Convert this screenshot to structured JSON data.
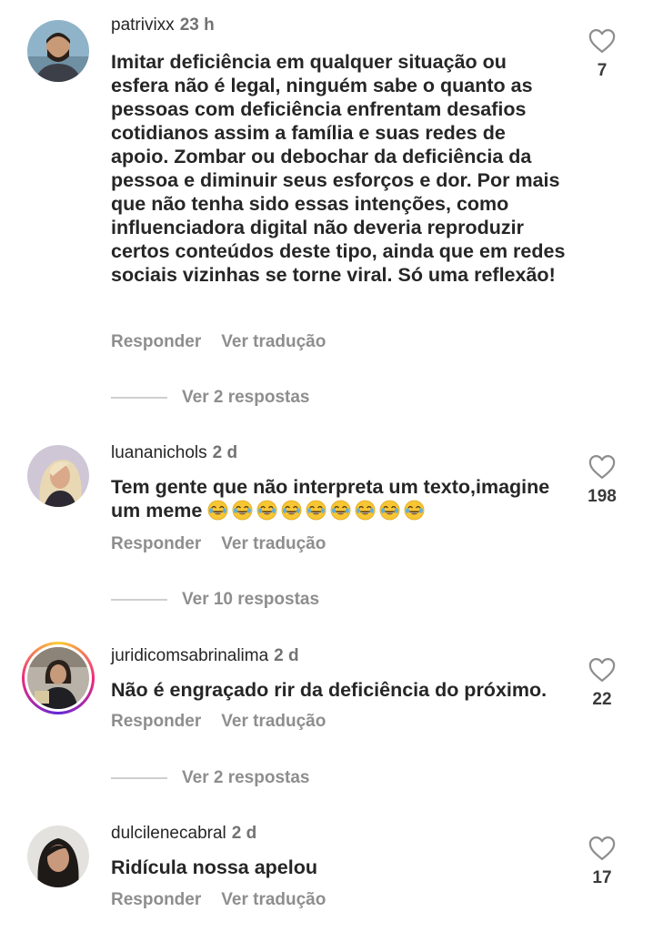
{
  "comments": [
    {
      "username": "patrivixx",
      "time": "23 h",
      "text": "Imitar deficiência em qualquer situação ou esfera não é legal, ninguém sabe o quanto as pessoas com deficiência enfrentam desafios cotidianos assim a família e suas redes de apoio. Zombar ou debochar da deficiência da pessoa e diminuir seus esforços e dor. Por mais que não tenha sido essas intenções, como influenciadora digital não deveria reproduzir certos conteúdos deste tipo, ainda que em redes sociais vizinhas se torne viral. Só uma reflexão!",
      "likes": "7",
      "reply_label": "Responder",
      "translate_label": "Ver tradução",
      "view_replies": "Ver 2 respostas"
    },
    {
      "username": "luananichols",
      "time": "2 d",
      "text": "Tem gente que não interpreta um texto,imagine um meme",
      "emoji": "😂😂😂😂😂😂😂😂😂",
      "likes": "198",
      "reply_label": "Responder",
      "translate_label": "Ver tradução",
      "view_replies": "Ver 10 respostas"
    },
    {
      "username": "juridicomsabrinalima",
      "time": "2 d",
      "text": "Não é engraçado rir da deficiência do próximo.",
      "likes": "22",
      "reply_label": "Responder",
      "translate_label": "Ver tradução",
      "view_replies": "Ver 2 respostas"
    },
    {
      "username": "dulcilenecabral",
      "time": "2 d",
      "text": "Ridícula nossa apelou",
      "likes": "17",
      "reply_label": "Responder",
      "translate_label": "Ver tradução"
    }
  ],
  "icons": {
    "like": "heart-outline-icon",
    "emoji": "face-with-tears-of-joy"
  },
  "colors": {
    "text": "#262626",
    "muted": "#8e8e8e",
    "story_ring": "#ee2a7b"
  }
}
